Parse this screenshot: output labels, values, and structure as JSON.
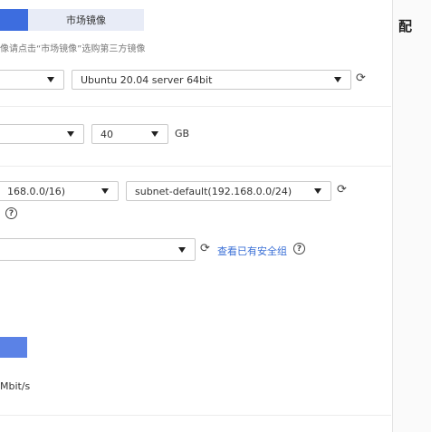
{
  "image_tabs": {
    "market": "市场镜像"
  },
  "image_hint": "像请点击“市场镜像”选购第三方镜像",
  "image": {
    "os_select": "",
    "version_select": "Ubuntu 20.04 server 64bit"
  },
  "disk": {
    "type_select": "",
    "size_select": "40",
    "unit": "GB"
  },
  "network": {
    "vpc_select": "168.0.0/16)",
    "subnet_select": "subnet-default(192.168.0.0/24)"
  },
  "security_group": {
    "select": "",
    "view_link": "查看已有安全组"
  },
  "bandwidth": {
    "unit": "Mbit/s"
  },
  "side_panel": {
    "title": "配"
  },
  "icons": {
    "refresh": "refresh-icon",
    "help": "question-circle-icon",
    "dropdown": "caret-down-icon"
  },
  "colors": {
    "primary": "#3d6ddf",
    "tab_inactive": "#e8ecf7",
    "link": "#3a6fd6"
  }
}
